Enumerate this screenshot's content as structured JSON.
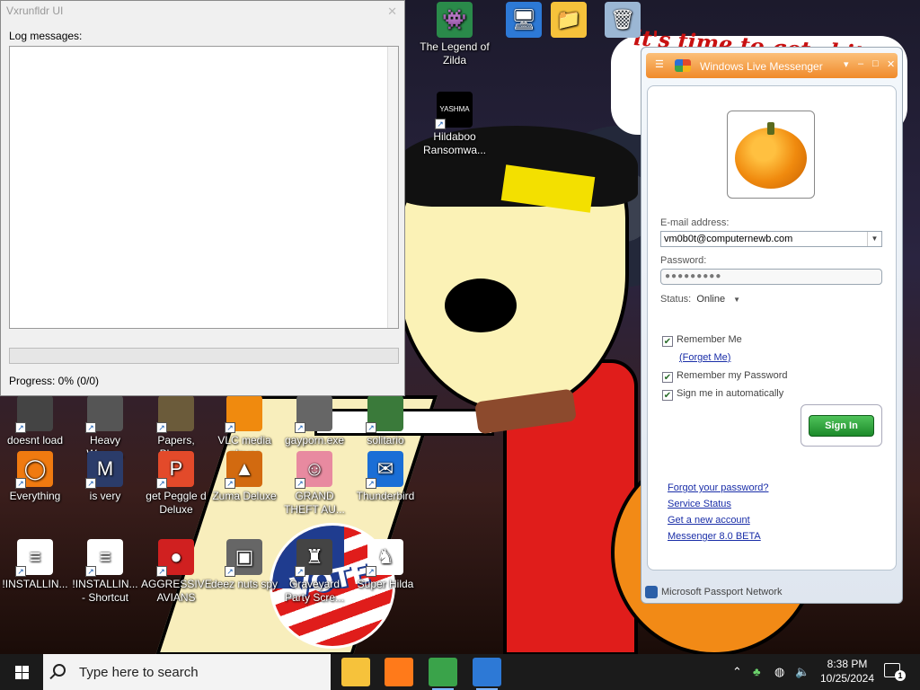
{
  "desktop": {
    "wallpaper_scrawl": "it's time to get shit",
    "wallpaper_flag_text": "VOTE",
    "icons": [
      {
        "label": "The Legend of Zilda",
        "color": "#2a8a4a",
        "glyph": "👾"
      },
      {
        "label": "",
        "color": "#2d79d6",
        "glyph": "🖥"
      },
      {
        "label": "",
        "color": "#f6c23b",
        "glyph": "📁"
      },
      {
        "label": "",
        "color": "#9bb7d4",
        "glyph": "🗑"
      },
      {
        "label": "Hildaboo Ransomwa...",
        "color": "#000000",
        "glyph": "YASHMA"
      },
      {
        "label": "doesnt load",
        "color": "#444444",
        "glyph": ""
      },
      {
        "label": "Heavy Weap...",
        "color": "#555555",
        "glyph": ""
      },
      {
        "label": "Papers, Please",
        "color": "#6b5b3a",
        "glyph": ""
      },
      {
        "label": "VLC media player",
        "color": "#f08a0e",
        "glyph": ""
      },
      {
        "label": "gayporn.exe",
        "color": "#666666",
        "glyph": ""
      },
      {
        "label": "solitario",
        "color": "#3a7a3a",
        "glyph": ""
      },
      {
        "label": "Everything",
        "color": "#f07a10",
        "glyph": "◯"
      },
      {
        "label": "is very",
        "color": "#2b3c6a",
        "glyph": "M"
      },
      {
        "label": "get Peggle d Deluxe",
        "color": "#e34a2a",
        "glyph": "P"
      },
      {
        "label": "Zuma Deluxe",
        "color": "#d26a10",
        "glyph": "▲"
      },
      {
        "label": "GRAND THEFT AU...",
        "color": "#e88aa0",
        "glyph": "☺"
      },
      {
        "label": "Thunderbird",
        "color": "#1a6ed6",
        "glyph": "✉"
      },
      {
        "label": "!INSTALLIN...",
        "color": "#ffffff",
        "glyph": "≡"
      },
      {
        "label": "!INSTALLIN... - Shortcut",
        "color": "#ffffff",
        "glyph": "≡"
      },
      {
        "label": "AGGRESSIVE AVIANS",
        "color": "#d02020",
        "glyph": "●"
      },
      {
        "label": "deez nuts spy",
        "color": "#666666",
        "glyph": "▣"
      },
      {
        "label": "Graveyard Party Scre...",
        "color": "#444444",
        "glyph": "♜"
      },
      {
        "label": "Super Hilda",
        "color": "#ffffff",
        "glyph": "♞"
      }
    ]
  },
  "vxrunfldr": {
    "title": "Vxrunfldr UI",
    "close_glyph": "✕",
    "log_label": "Log messages:",
    "progress_fraction": 0,
    "progress_text": "Progress: 0% (0/0)"
  },
  "messenger": {
    "title": "Windows Live Messenger",
    "email_label": "E-mail address:",
    "email_value": "vm0b0t@computernewb.com",
    "password_label": "Password:",
    "password_value": "●●●●●●●●●",
    "status_label": "Status:",
    "status_value": "Online",
    "remember_me": "Remember Me",
    "forget_me": "(Forget Me)",
    "remember_password": "Remember my Password",
    "sign_in_auto": "Sign me in automatically",
    "sign_in_button": "Sign In",
    "links": [
      "Forgot your password?",
      "Service Status",
      "Get a new account",
      "Messenger 8.0 BETA"
    ],
    "footer": "Microsoft Passport Network",
    "checks": [
      true,
      true,
      true
    ]
  },
  "taskbar": {
    "search_placeholder": "Type here to search",
    "time": "8:38 PM",
    "date": "10/25/2024",
    "notification_count": "1",
    "apps": [
      {
        "name": "file-explorer",
        "color": "#f6c23b",
        "active": false
      },
      {
        "name": "firefox",
        "color": "#ff7a1a",
        "active": false
      },
      {
        "name": "messenger",
        "color": "#3aa34a",
        "active": true
      },
      {
        "name": "vxrunfldr",
        "color": "#2d79d6",
        "active": true
      }
    ]
  }
}
